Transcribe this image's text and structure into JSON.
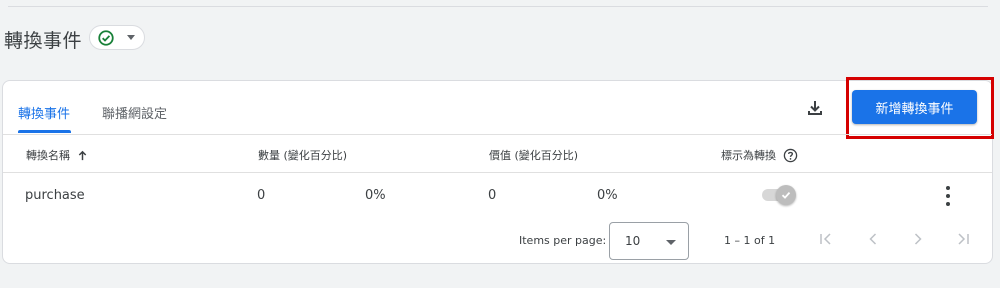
{
  "header": {
    "title": "轉換事件",
    "status_icon": "check-circle-icon",
    "status_color": "#188038"
  },
  "tabs": [
    {
      "label": "轉換事件",
      "active": true
    },
    {
      "label": "聯播網設定",
      "active": false
    }
  ],
  "toolbar": {
    "download_icon": "download-icon",
    "new_button_label": "新增轉換事件"
  },
  "table": {
    "columns": {
      "name": "轉換名稱",
      "count": "數量 (變化百分比)",
      "value": "價值 (變化百分比)",
      "mark": "標示為轉換"
    },
    "rows": [
      {
        "name": "purchase",
        "count": "0",
        "count_change": "0%",
        "value": "0",
        "value_change": "0%",
        "marked": true
      }
    ]
  },
  "pagination": {
    "items_per_page_label": "Items per page:",
    "items_per_page": "10",
    "range": "1 – 1 of 1"
  },
  "colors": {
    "accent": "#1a73e8",
    "highlight": "#d50000"
  }
}
